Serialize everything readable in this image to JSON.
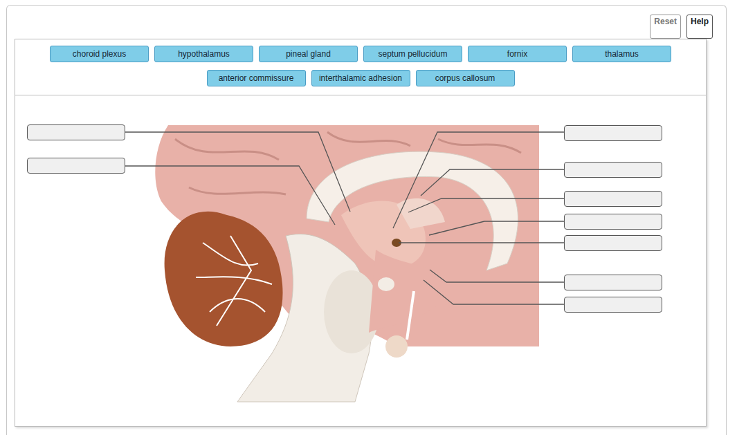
{
  "header_buttons": [
    "Reset",
    "Help"
  ],
  "word_bank": [
    [
      "choroid plexus",
      "hypothalamus",
      "pineal gland",
      "septum pellucidum",
      "fornix",
      "thalamus"
    ],
    [
      "anterior commissure",
      "interthalamic adhesion",
      "corpus callosum"
    ]
  ],
  "drop_zones": [
    {
      "filled": false
    },
    {
      "filled": false
    },
    {
      "filled": false
    },
    {
      "filled": false
    },
    {
      "filled": false
    },
    {
      "filled": false
    },
    {
      "filled": false
    },
    {
      "filled": false
    },
    {
      "filled": false
    }
  ]
}
